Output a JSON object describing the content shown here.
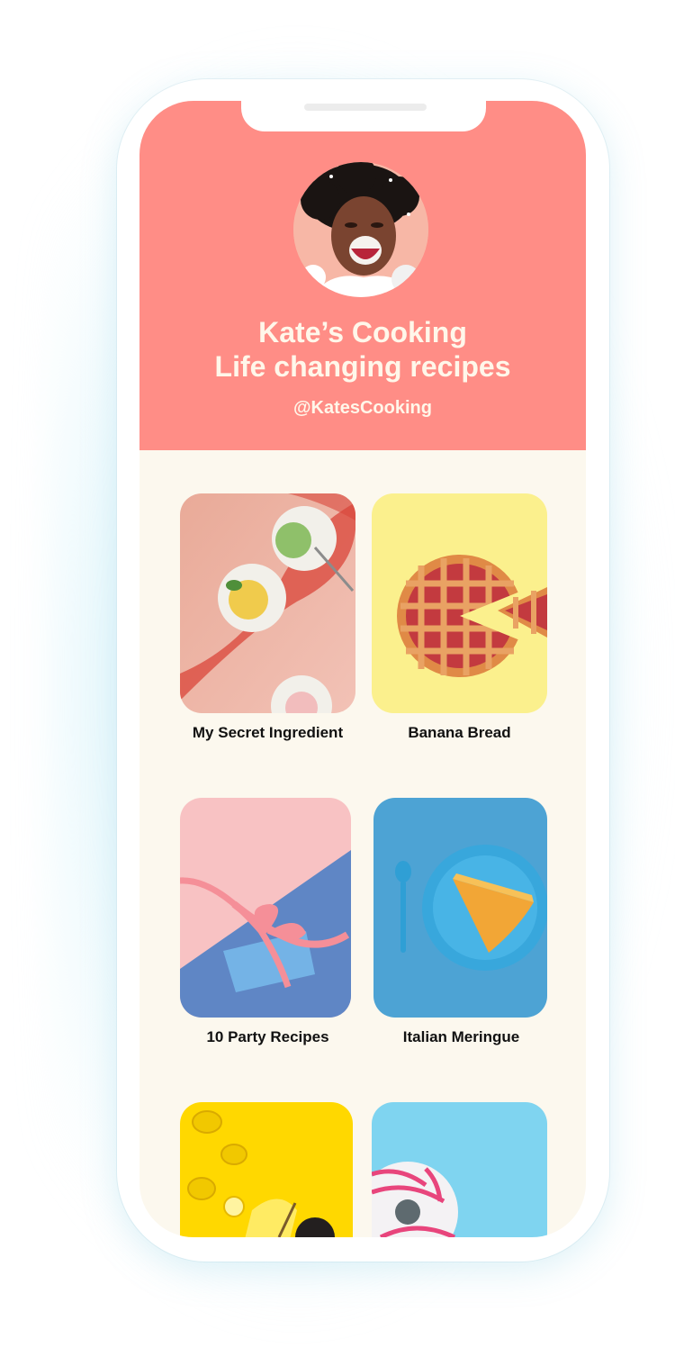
{
  "profile": {
    "title_line1": "Kate’s Cooking",
    "title_line2": "Life changing recipes",
    "handle": "@KatesCooking"
  },
  "colors": {
    "header_bg": "#ff8d86",
    "content_bg": "#fcf8ee",
    "title_text": "#fff7ea"
  },
  "cards": [
    {
      "label": "My Secret Ingredient",
      "icon": "ice-cream-photo"
    },
    {
      "label": "Banana Bread",
      "icon": "pie-photo"
    },
    {
      "label": "10 Party Recipes",
      "icon": "gift-photo"
    },
    {
      "label": "Italian Meringue",
      "icon": "cake-slice-photo"
    },
    {
      "label": "",
      "icon": "lemons-photo"
    },
    {
      "label": "",
      "icon": "donut-photo"
    }
  ]
}
